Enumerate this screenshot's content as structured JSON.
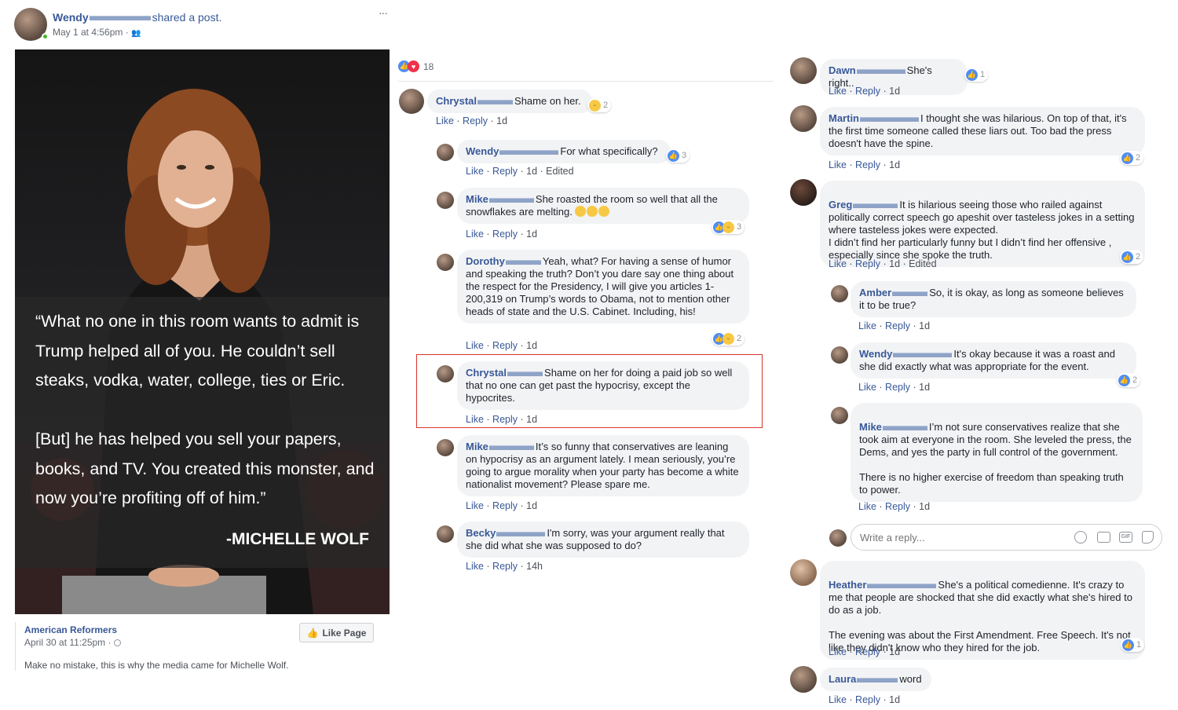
{
  "post": {
    "author": "Wendy",
    "action": "shared a post.",
    "time": "May 1 at 4:56pm · ",
    "more": "···",
    "image_quote": "“What no one in this room wants to admit is Trump helped all of you. He couldn’t sell steaks, vodka, water, college, ties or Eric.\n\n[But] he has helped you sell your papers, books, and TV. You created this monster, and now you’re profiting off of him.”",
    "image_author": "-MICHELLE WOLF",
    "page_name": "American Reformers",
    "page_time": "April 30 at 11:25pm · ",
    "like_page": "Like Page",
    "caption": "Make no mistake, this is why the media came for Michelle Wolf.",
    "reaction_count": "18"
  },
  "labels": {
    "like": "Like",
    "reply": "Reply"
  },
  "middle_comments": [
    {
      "name": "Chrystal",
      "text": "Shame on her.",
      "meta": "1d",
      "react": "2"
    },
    {
      "name": "Wendy",
      "text": "For what specifically?",
      "meta": "1d · Edited",
      "react": "3"
    },
    {
      "name": "Mike",
      "text": "She roasted the room so well that all the snowflakes are melting.",
      "meta": "1d",
      "react": "3"
    },
    {
      "name": "Dorothy",
      "text": "Yeah, what? For having a sense of humor and speaking the truth? Don’t you dare say one thing about the respect for the Presidency, I will give you articles 1-200,319 on Trump’s words to Obama, not to mention other heads of state and the U.S. Cabinet. Including, his!",
      "meta": "1d",
      "react": "2"
    },
    {
      "name": "Chrystal",
      "text": "Shame on her for doing a paid job so well that no one can get past the hypocrisy, except the hypocrites.",
      "meta": "1d"
    },
    {
      "name": "Mike",
      "text": "It’s so funny that conservatives are leaning on hypocrisy as an argument lately. I mean seriously, you’re going to argue morality when your party has become a white nationalist movement? Please spare me.",
      "meta": "1d"
    },
    {
      "name": "Becky",
      "text": "I'm sorry, was your argument really that she did what she was supposed to do?",
      "meta": "14h"
    }
  ],
  "right_comments": [
    {
      "name": "Dawn",
      "text": "She's right..",
      "meta": "1d",
      "react": "1"
    },
    {
      "name": "Martin",
      "text": "I thought she was hilarious. On top of that, it's the first time someone called these liars out. Too bad the press doesn't have the spine.",
      "meta": "1d",
      "react": "2"
    },
    {
      "name": "Greg",
      "text": "It is hilarious seeing those who railed against politically correct speech go apeshit over tasteless jokes in a setting where tasteless jokes were expected.\nI didn’t find her particularly funny but I didn’t find her offensive , especially since she spoke the truth.",
      "meta": "1d · Edited",
      "react": "2"
    },
    {
      "name": "Amber",
      "text": "So, it is okay, as long as someone believes it to be true?",
      "meta": "1d"
    },
    {
      "name": "Wendy",
      "text": "It's okay because it was a roast and she did exactly what was appropriate for the event.",
      "meta": "1d",
      "react": "2"
    },
    {
      "name": "Mike",
      "text": "I’m not sure conservatives realize that she took aim at everyone in the room. She leveled the press, the Dems, and yes the party in full control of the government.\n\nThere is no higher exercise of freedom than speaking truth to power.",
      "meta": "1d"
    },
    {
      "name": "Heather",
      "text": "She's a political comedienne. It's crazy to me that people are shocked that she did exactly what she's hired to do as a job.\n\nThe evening was about the First Amendment. Free Speech. It's not like they didn't know who they hired for the job.",
      "meta": "1d",
      "react": "1"
    },
    {
      "name": "Laura",
      "text": "word",
      "meta": "1d"
    }
  ],
  "reply_box": {
    "placeholder": "Write a reply..."
  },
  "colors": {
    "link": "#385898",
    "bubble": "#f2f3f5",
    "like_blue": "#4f8df7",
    "highlight": "#d9342b"
  }
}
